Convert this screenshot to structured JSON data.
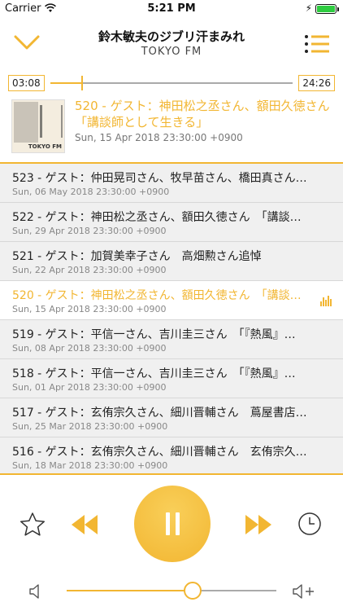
{
  "status_bar": {
    "carrier": "Carrier",
    "time": "5:21 PM",
    "battery_level": 1.0
  },
  "header": {
    "title": "鈴木敏夫のジブリ汗まみれ",
    "subtitle": "TOKYO FM",
    "back_icon": "chevron-down-icon",
    "menu_icon": "list-menu-icon"
  },
  "player": {
    "elapsed": "03:08",
    "remaining": "24:26",
    "progress": 0.128
  },
  "now_playing": {
    "title": "520 - ゲスト：神田松之丞さん、額田久徳さん　「講談師として生きる」",
    "date": "Sun, 15 Apr 2018 23:30:00 +0900",
    "artwork_logo": "TOKYO FM"
  },
  "episodes": [
    {
      "title": "523 - ゲスト：仲田晃司さん、牧早苗さん、橋田真さん…",
      "date": "Sun, 06 May 2018 23:30:00 +0900",
      "current": false
    },
    {
      "title": "522 - ゲスト：神田松之丞さん、額田久徳さん　「講談…",
      "date": "Sun, 29 Apr 2018 23:30:00 +0900",
      "current": false
    },
    {
      "title": "521 - ゲスト：加賀美幸子さん　高畑勲さん追悼",
      "date": "Sun, 22 Apr 2018 23:30:00 +0900",
      "current": false
    },
    {
      "title": "520 - ゲスト：神田松之丞さん、額田久徳さん　「講談…",
      "date": "Sun, 15 Apr 2018 23:30:00 +0900",
      "current": true
    },
    {
      "title": "519 - ゲスト：平信一さん、吉川圭三さん　「『熱風』…",
      "date": "Sun, 08 Apr 2018 23:30:00 +0900",
      "current": false
    },
    {
      "title": "518 - ゲスト：平信一さん、吉川圭三さん　「『熱風』…",
      "date": "Sun, 01 Apr 2018 23:30:00 +0900",
      "current": false
    },
    {
      "title": "517 - ゲスト：玄侑宗久さん、細川晋輔さん　蔦屋書店…",
      "date": "Sun, 25 Mar 2018 23:30:00 +0900",
      "current": false
    },
    {
      "title": "516 - ゲスト：玄侑宗久さん、細川晋輔さん　玄侑宗久…",
      "date": "Sun, 18 Mar 2018 23:30:00 +0900",
      "current": false
    }
  ],
  "controls": {
    "favorite_icon": "star-icon",
    "rewind_icon": "rewind-icon",
    "play_state_icon": "pause-icon",
    "forward_icon": "fast-forward-icon",
    "timer_icon": "clock-icon"
  },
  "volume": {
    "level": 0.6,
    "low_icon": "speaker-low-icon",
    "high_icon": "speaker-high-icon"
  },
  "colors": {
    "accent": "#f2b632",
    "list_bg": "#f0f0f0",
    "current_bg": "#ffffff"
  }
}
